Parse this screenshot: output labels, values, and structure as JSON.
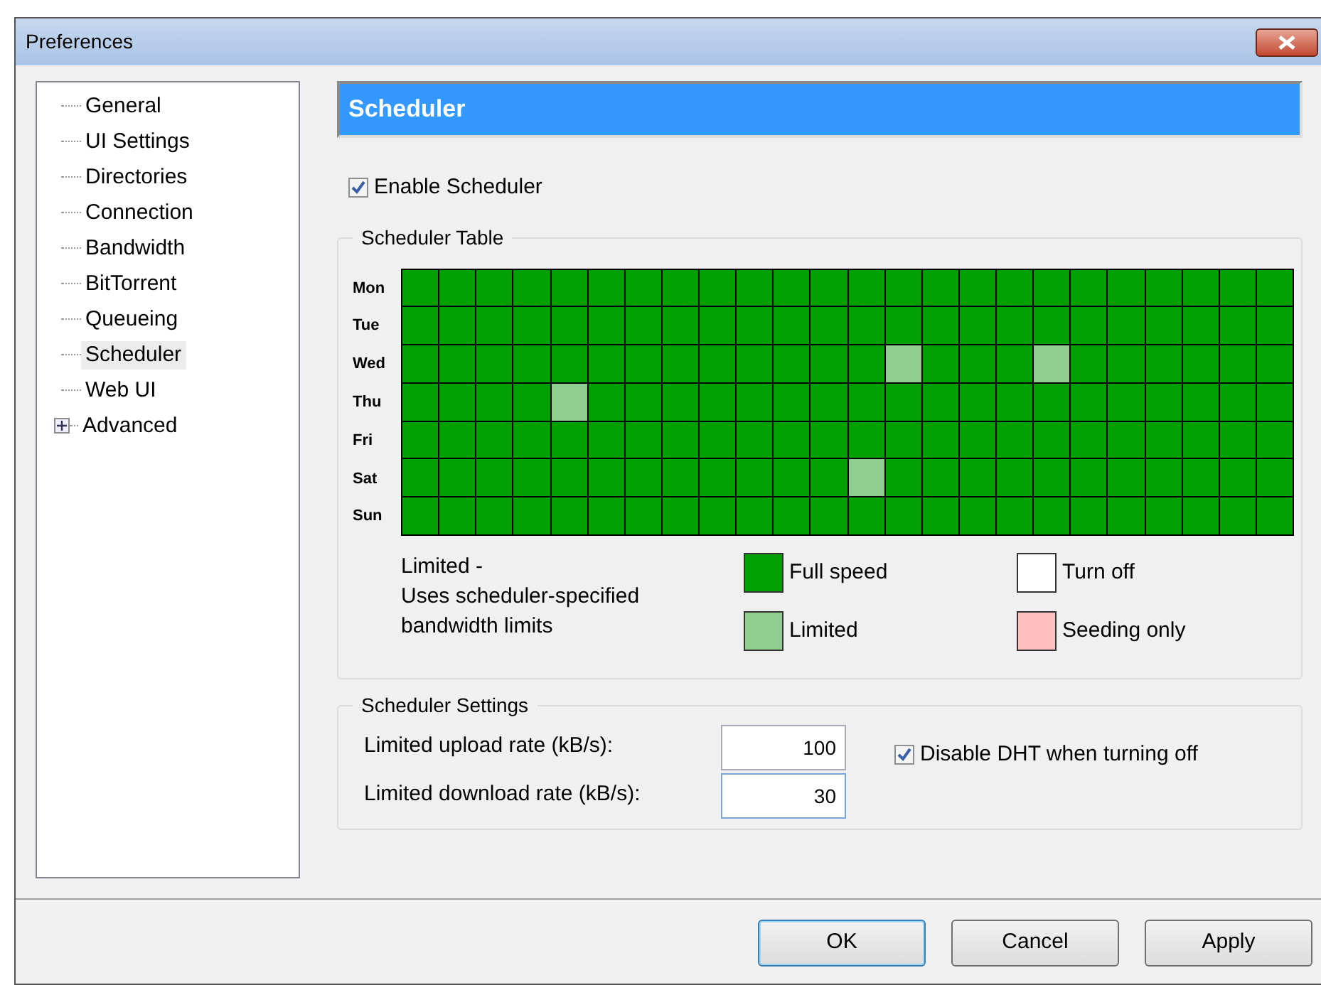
{
  "window": {
    "title": "Preferences"
  },
  "sidebar": {
    "items": [
      {
        "label": "General",
        "selected": false
      },
      {
        "label": "UI Settings",
        "selected": false
      },
      {
        "label": "Directories",
        "selected": false
      },
      {
        "label": "Connection",
        "selected": false
      },
      {
        "label": "Bandwidth",
        "selected": false
      },
      {
        "label": "BitTorrent",
        "selected": false
      },
      {
        "label": "Queueing",
        "selected": false
      },
      {
        "label": "Scheduler",
        "selected": true
      },
      {
        "label": "Web UI",
        "selected": false
      },
      {
        "label": "Advanced",
        "selected": false,
        "expanded": false
      }
    ]
  },
  "header": "Scheduler",
  "enable_scheduler": {
    "label": "Enable Scheduler",
    "checked": true
  },
  "scheduler_table": {
    "title": "Scheduler Table",
    "days": [
      {
        "label": "Mon",
        "slots": [
          {
            "limited": false
          },
          {
            "limited": false
          },
          {
            "limited": false
          },
          {
            "limited": false
          },
          {
            "limited": false
          },
          {
            "limited": false
          },
          {
            "limited": false
          },
          {
            "limited": false
          },
          {
            "limited": false
          },
          {
            "limited": false
          },
          {
            "limited": false
          },
          {
            "limited": false
          },
          {
            "limited": false
          },
          {
            "limited": false
          },
          {
            "limited": false
          },
          {
            "limited": false
          },
          {
            "limited": false
          },
          {
            "limited": false
          },
          {
            "limited": false
          },
          {
            "limited": false
          },
          {
            "limited": false
          },
          {
            "limited": false
          },
          {
            "limited": false
          },
          {
            "limited": false
          }
        ]
      },
      {
        "label": "Tue",
        "slots": [
          {
            "limited": false
          },
          {
            "limited": false
          },
          {
            "limited": false
          },
          {
            "limited": false
          },
          {
            "limited": false
          },
          {
            "limited": false
          },
          {
            "limited": false
          },
          {
            "limited": false
          },
          {
            "limited": false
          },
          {
            "limited": false
          },
          {
            "limited": false
          },
          {
            "limited": false
          },
          {
            "limited": false
          },
          {
            "limited": false
          },
          {
            "limited": false
          },
          {
            "limited": false
          },
          {
            "limited": false
          },
          {
            "limited": false
          },
          {
            "limited": false
          },
          {
            "limited": false
          },
          {
            "limited": false
          },
          {
            "limited": false
          },
          {
            "limited": false
          },
          {
            "limited": false
          }
        ]
      },
      {
        "label": "Wed",
        "slots": [
          {
            "limited": false
          },
          {
            "limited": false
          },
          {
            "limited": false
          },
          {
            "limited": false
          },
          {
            "limited": false
          },
          {
            "limited": false
          },
          {
            "limited": false
          },
          {
            "limited": false
          },
          {
            "limited": false
          },
          {
            "limited": false
          },
          {
            "limited": false
          },
          {
            "limited": false
          },
          {
            "limited": false
          },
          {
            "limited": true
          },
          {
            "limited": false
          },
          {
            "limited": false
          },
          {
            "limited": false
          },
          {
            "limited": true
          },
          {
            "limited": false
          },
          {
            "limited": false
          },
          {
            "limited": false
          },
          {
            "limited": false
          },
          {
            "limited": false
          },
          {
            "limited": false
          }
        ]
      },
      {
        "label": "Thu",
        "slots": [
          {
            "limited": false
          },
          {
            "limited": false
          },
          {
            "limited": false
          },
          {
            "limited": false
          },
          {
            "limited": true
          },
          {
            "limited": false
          },
          {
            "limited": false
          },
          {
            "limited": false
          },
          {
            "limited": false
          },
          {
            "limited": false
          },
          {
            "limited": false
          },
          {
            "limited": false
          },
          {
            "limited": false
          },
          {
            "limited": false
          },
          {
            "limited": false
          },
          {
            "limited": false
          },
          {
            "limited": false
          },
          {
            "limited": false
          },
          {
            "limited": false
          },
          {
            "limited": false
          },
          {
            "limited": false
          },
          {
            "limited": false
          },
          {
            "limited": false
          },
          {
            "limited": false
          }
        ]
      },
      {
        "label": "Fri",
        "slots": [
          {
            "limited": false
          },
          {
            "limited": false
          },
          {
            "limited": false
          },
          {
            "limited": false
          },
          {
            "limited": false
          },
          {
            "limited": false
          },
          {
            "limited": false
          },
          {
            "limited": false
          },
          {
            "limited": false
          },
          {
            "limited": false
          },
          {
            "limited": false
          },
          {
            "limited": false
          },
          {
            "limited": false
          },
          {
            "limited": false
          },
          {
            "limited": false
          },
          {
            "limited": false
          },
          {
            "limited": false
          },
          {
            "limited": false
          },
          {
            "limited": false
          },
          {
            "limited": false
          },
          {
            "limited": false
          },
          {
            "limited": false
          },
          {
            "limited": false
          },
          {
            "limited": false
          }
        ]
      },
      {
        "label": "Sat",
        "slots": [
          {
            "limited": false
          },
          {
            "limited": false
          },
          {
            "limited": false
          },
          {
            "limited": false
          },
          {
            "limited": false
          },
          {
            "limited": false
          },
          {
            "limited": false
          },
          {
            "limited": false
          },
          {
            "limited": false
          },
          {
            "limited": false
          },
          {
            "limited": false
          },
          {
            "limited": false
          },
          {
            "limited": true
          },
          {
            "limited": false
          },
          {
            "limited": false
          },
          {
            "limited": false
          },
          {
            "limited": false
          },
          {
            "limited": false
          },
          {
            "limited": false
          },
          {
            "limited": false
          },
          {
            "limited": false
          },
          {
            "limited": false
          },
          {
            "limited": false
          },
          {
            "limited": false
          }
        ]
      },
      {
        "label": "Sun",
        "slots": [
          {
            "limited": false
          },
          {
            "limited": false
          },
          {
            "limited": false
          },
          {
            "limited": false
          },
          {
            "limited": false
          },
          {
            "limited": false
          },
          {
            "limited": false
          },
          {
            "limited": false
          },
          {
            "limited": false
          },
          {
            "limited": false
          },
          {
            "limited": false
          },
          {
            "limited": false
          },
          {
            "limited": false
          },
          {
            "limited": false
          },
          {
            "limited": false
          },
          {
            "limited": false
          },
          {
            "limited": false
          },
          {
            "limited": false
          },
          {
            "limited": false
          },
          {
            "limited": false
          },
          {
            "limited": false
          },
          {
            "limited": false
          },
          {
            "limited": false
          },
          {
            "limited": false
          }
        ]
      }
    ],
    "description": [
      "Limited -",
      "Uses scheduler-specified",
      "bandwidth limits"
    ],
    "legend": [
      {
        "kind": "full",
        "label": "Full speed",
        "color": "#00a000"
      },
      {
        "kind": "off",
        "label": "Turn off",
        "color": "#ffffff"
      },
      {
        "kind": "limited",
        "label": "Limited",
        "color": "#8fce8f"
      },
      {
        "kind": "seeding",
        "label": "Seeding only",
        "color": "#ffc0c0"
      }
    ]
  },
  "scheduler_settings": {
    "title": "Scheduler Settings",
    "fields": [
      {
        "label": "Limited upload rate (kB/s):",
        "value": "100",
        "focused": false
      },
      {
        "label": "Limited download rate (kB/s):",
        "value": "30",
        "focused": true
      }
    ],
    "disable_dht": {
      "label": "Disable DHT when turning off",
      "checked": true
    }
  },
  "buttons": [
    {
      "label": "OK",
      "default": true
    },
    {
      "label": "Cancel",
      "default": false
    },
    {
      "label": "Apply",
      "default": false
    }
  ]
}
